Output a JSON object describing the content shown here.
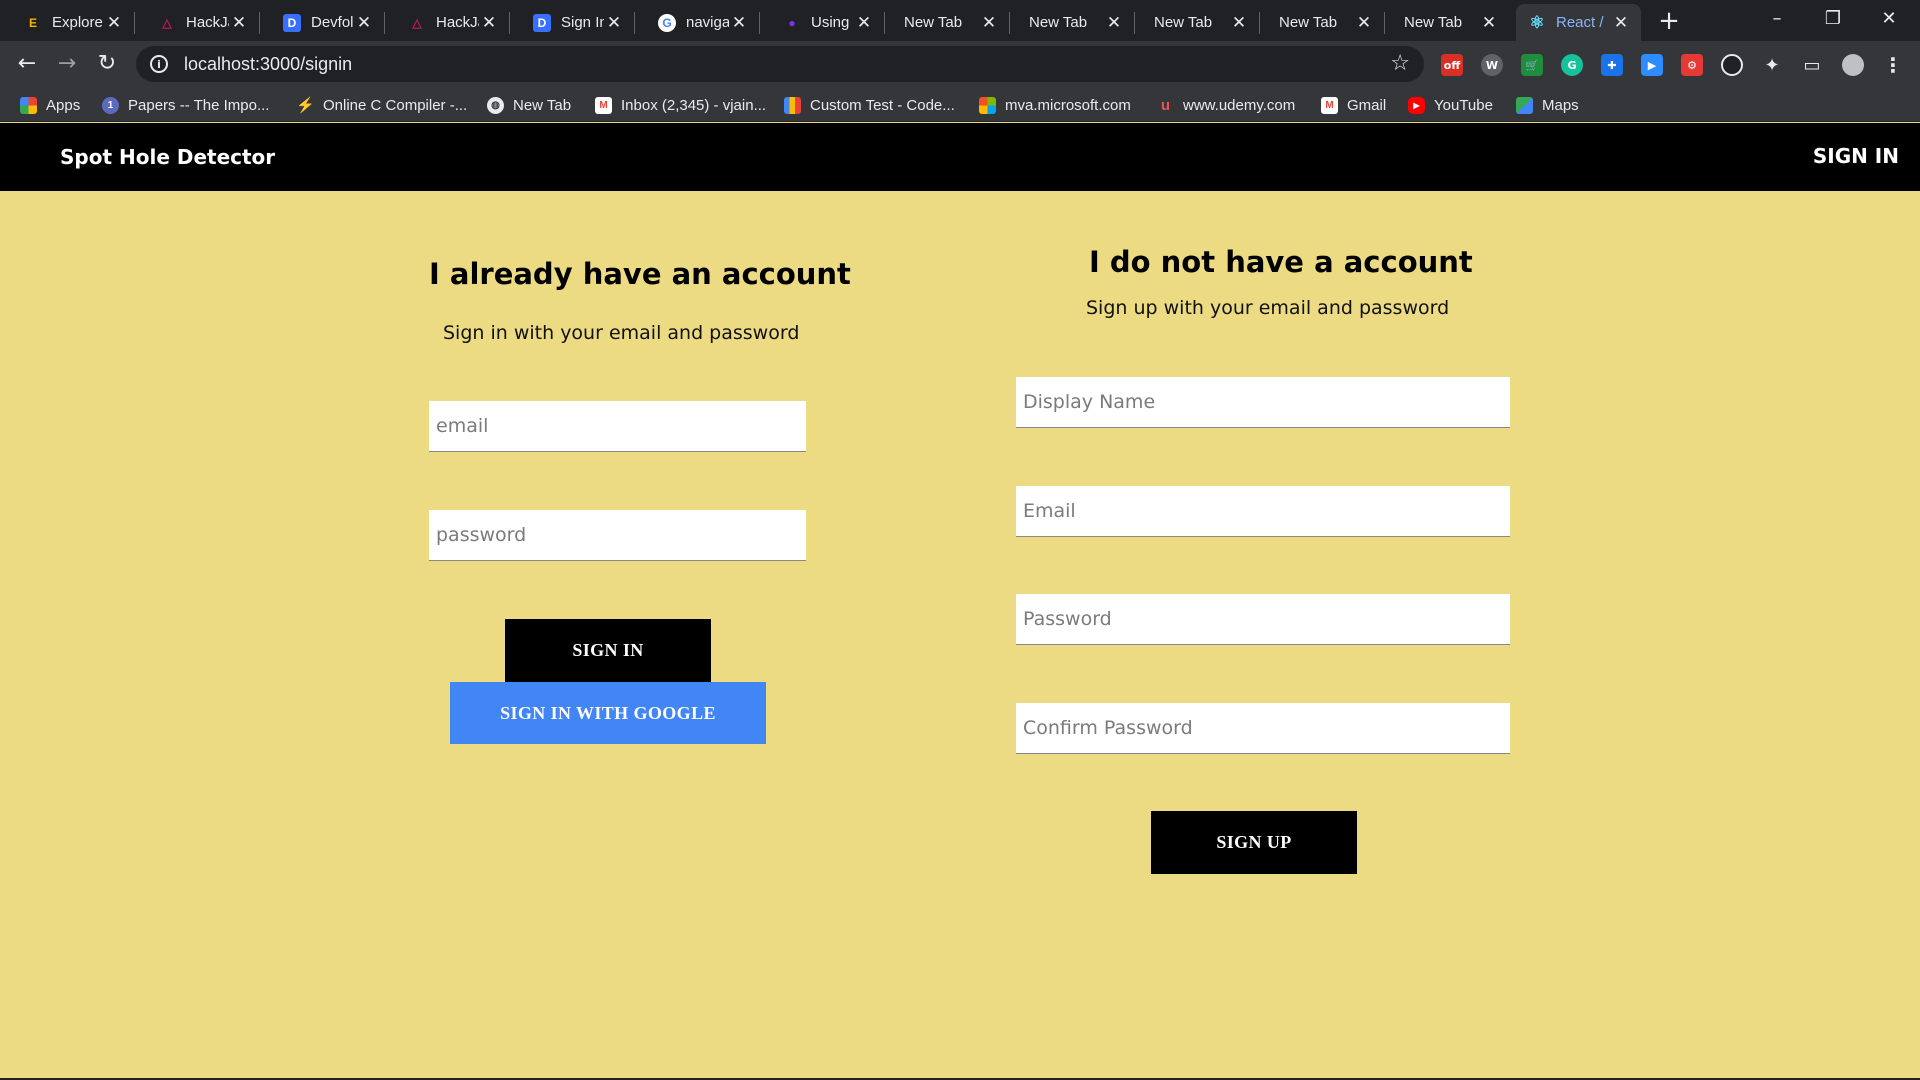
{
  "browser": {
    "tabs": [
      {
        "title": "Explore",
        "fav_color": "#f4b400",
        "fav_glyph": "E"
      },
      {
        "title": "HackJa",
        "fav_color": "#c2185b",
        "fav_glyph": "△"
      },
      {
        "title": "Devfoli",
        "fav_color": "#3770ff",
        "fav_glyph": "D"
      },
      {
        "title": "HackJa",
        "fav_color": "#c2185b",
        "fav_glyph": "△"
      },
      {
        "title": "Sign In",
        "fav_color": "#3770ff",
        "fav_glyph": "D"
      },
      {
        "title": "naviga",
        "fav_color": "#ffffff",
        "fav_glyph": "G"
      },
      {
        "title": "Using",
        "fav_color": "#7b2ff7",
        "fav_glyph": "●"
      },
      {
        "title": "New Tab",
        "fav_color": "",
        "fav_glyph": ""
      },
      {
        "title": "New Tab",
        "fav_color": "",
        "fav_glyph": ""
      },
      {
        "title": "New Tab",
        "fav_color": "",
        "fav_glyph": ""
      },
      {
        "title": "New Tab",
        "fav_color": "",
        "fav_glyph": ""
      },
      {
        "title": "New Tab",
        "fav_color": "",
        "fav_glyph": ""
      },
      {
        "title": "React /",
        "fav_color": "#61dafb",
        "fav_glyph": "⚛",
        "active": true
      }
    ],
    "url": "localhost:3000/signin",
    "bookmarks": [
      {
        "label": "Apps",
        "icon": "apps-grid-icon",
        "color": "#ea4335"
      },
      {
        "label": "Papers -- The Impo...",
        "icon": "papers-icon",
        "color": "#5c6bc0"
      },
      {
        "label": "Online C Compiler -...",
        "icon": "bolt-icon",
        "color": "#7c4dff"
      },
      {
        "label": "New Tab",
        "icon": "globe-icon",
        "color": "#e8eaed"
      },
      {
        "label": "Inbox (2,345) - vjain...",
        "icon": "gmail-icon",
        "color": "#ea4335"
      },
      {
        "label": "Custom Test - Code...",
        "icon": "codechef-icon",
        "color": "#fbbc04"
      },
      {
        "label": "mva.microsoft.com",
        "icon": "microsoft-icon",
        "color": "#f25022"
      },
      {
        "label": "www.udemy.com",
        "icon": "udemy-icon",
        "color": "#ec5252"
      },
      {
        "label": "Gmail",
        "icon": "gmail-icon",
        "color": "#ea4335"
      },
      {
        "label": "YouTube",
        "icon": "youtube-icon",
        "color": "#ff0000"
      },
      {
        "label": "Maps",
        "icon": "maps-icon",
        "color": "#34a853"
      }
    ]
  },
  "app": {
    "brand": "Spot Hole Detector",
    "nav_signin": "SIGN IN",
    "background_color": "#ecdb83"
  },
  "signin": {
    "heading": "I already have an account",
    "subtitle": "Sign in with your email and password",
    "email_placeholder": "email",
    "password_placeholder": "password",
    "submit_label": "SIGN IN",
    "google_label": "SIGN IN WITH GOOGLE",
    "google_color": "#4285f4"
  },
  "signup": {
    "heading": "I do not have a account",
    "subtitle": "Sign up with your email and password",
    "display_name_placeholder": "Display Name",
    "email_placeholder": "Email",
    "password_placeholder": "Password",
    "confirm_password_placeholder": "Confirm Password",
    "submit_label": "SIGN UP"
  }
}
